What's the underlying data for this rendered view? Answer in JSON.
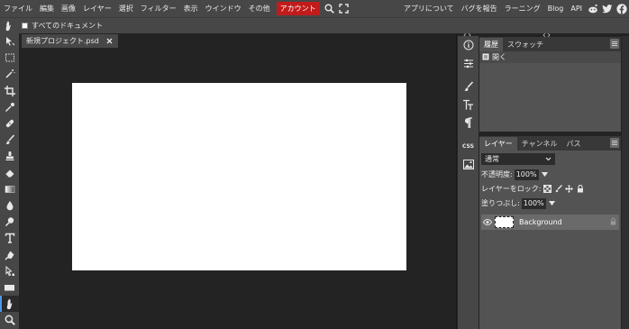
{
  "menubar": {
    "items": [
      {
        "name": "menu-file",
        "label": "ファイル"
      },
      {
        "name": "menu-edit",
        "label": "編集"
      },
      {
        "name": "menu-image",
        "label": "画像"
      },
      {
        "name": "menu-layer",
        "label": "レイヤー"
      },
      {
        "name": "menu-select",
        "label": "選択"
      },
      {
        "name": "menu-filter",
        "label": "フィルター"
      },
      {
        "name": "menu-view",
        "label": "表示"
      },
      {
        "name": "menu-window",
        "label": "ウインドウ"
      },
      {
        "name": "menu-more",
        "label": "その他"
      }
    ],
    "account_label": "アカウント",
    "account_color": "#c21b1b",
    "right_items": [
      {
        "name": "menu-about",
        "label": "アプリについて"
      },
      {
        "name": "menu-report-bug",
        "label": "バグを報告"
      },
      {
        "name": "menu-learning",
        "label": "ラーニング"
      },
      {
        "name": "menu-blog",
        "label": "Blog"
      },
      {
        "name": "menu-api",
        "label": "API"
      }
    ],
    "social_icons": [
      "reddit-icon",
      "twitter-icon",
      "facebook-icon"
    ]
  },
  "options": {
    "checkbox_label": "すべてのドキュメント",
    "checkbox_checked": false
  },
  "toolbar": {
    "tools": [
      "move-tool-icon",
      "marquee-tool-icon",
      "magic-wand-icon",
      "crop-tool-icon",
      "eyedropper-icon",
      "healing-brush-icon",
      "brush-tool-icon",
      "clone-stamp-icon",
      "eraser-icon",
      "gradient-tool-icon",
      "blur-tool-icon",
      "dodge-tool-icon",
      "type-tool-icon",
      "pen-tool-icon",
      "path-select-icon",
      "shape-tool-icon",
      "hand-tool-icon",
      "zoom-tool-icon"
    ],
    "active_tool": "hand-tool-icon"
  },
  "document": {
    "tab_label": "新規プロジェクト.psd",
    "canvas_color": "#ffffff"
  },
  "mini_panel": {
    "icons": [
      "info-icon",
      "adjustments-icon",
      "brush-settings-icon",
      "character-icon",
      "paragraph-icon",
      "css-icon",
      "image-icon"
    ],
    "css_label": "CSS"
  },
  "history_panel": {
    "tabs": [
      "履歴",
      "スウォッチ"
    ],
    "active_tab": "履歴",
    "entries": [
      {
        "label": "開く",
        "icon": "document-icon"
      }
    ]
  },
  "layers_panel": {
    "tabs": [
      "レイヤー",
      "チャンネル",
      "パス"
    ],
    "active_tab": "レイヤー",
    "blend_mode": "通常",
    "opacity_label": "不透明度:",
    "opacity_value": "100%",
    "lock_label": "レイヤーをロック:",
    "fill_label": "塗りつぶし:",
    "fill_value": "100%",
    "layers": [
      {
        "name": "Background",
        "visible": true,
        "locked": true
      }
    ]
  }
}
